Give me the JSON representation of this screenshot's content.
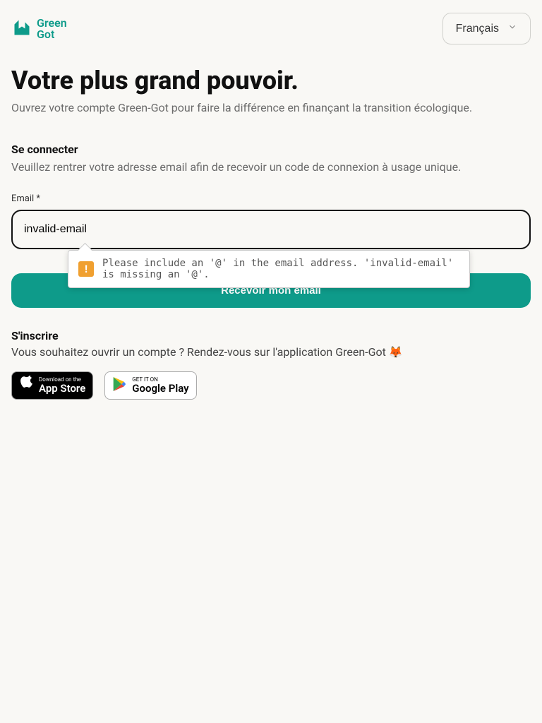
{
  "header": {
    "logo_text_line1": "Green",
    "logo_text_line2": "Got",
    "language": "Français"
  },
  "hero": {
    "title": "Votre plus grand pouvoir.",
    "subtitle": "Ouvrez votre compte Green-Got pour faire la différence en finançant la transition écologique."
  },
  "login": {
    "title": "Se connecter",
    "description": "Veuillez rentrer votre adresse email afin de recevoir un code de connexion à usage unique.",
    "email_label": "Email",
    "email_required_mark": "*",
    "email_value": "invalid-email",
    "submit_label": "Recevoir mon email",
    "validation_message": "Please include an '@' in the email address. 'invalid-email' is missing an '@'."
  },
  "signup": {
    "title": "S'inscrire",
    "description": "Vous souhaitez ouvrir un compte ? Rendez-vous sur l'application Green-Got 🦊"
  },
  "badges": {
    "appstore_small": "Download on the",
    "appstore_big": "App Store",
    "play_small": "GET IT ON",
    "play_big": "Google Play"
  },
  "colors": {
    "brand": "#0e9b8a",
    "bg": "#f9f8f5"
  }
}
